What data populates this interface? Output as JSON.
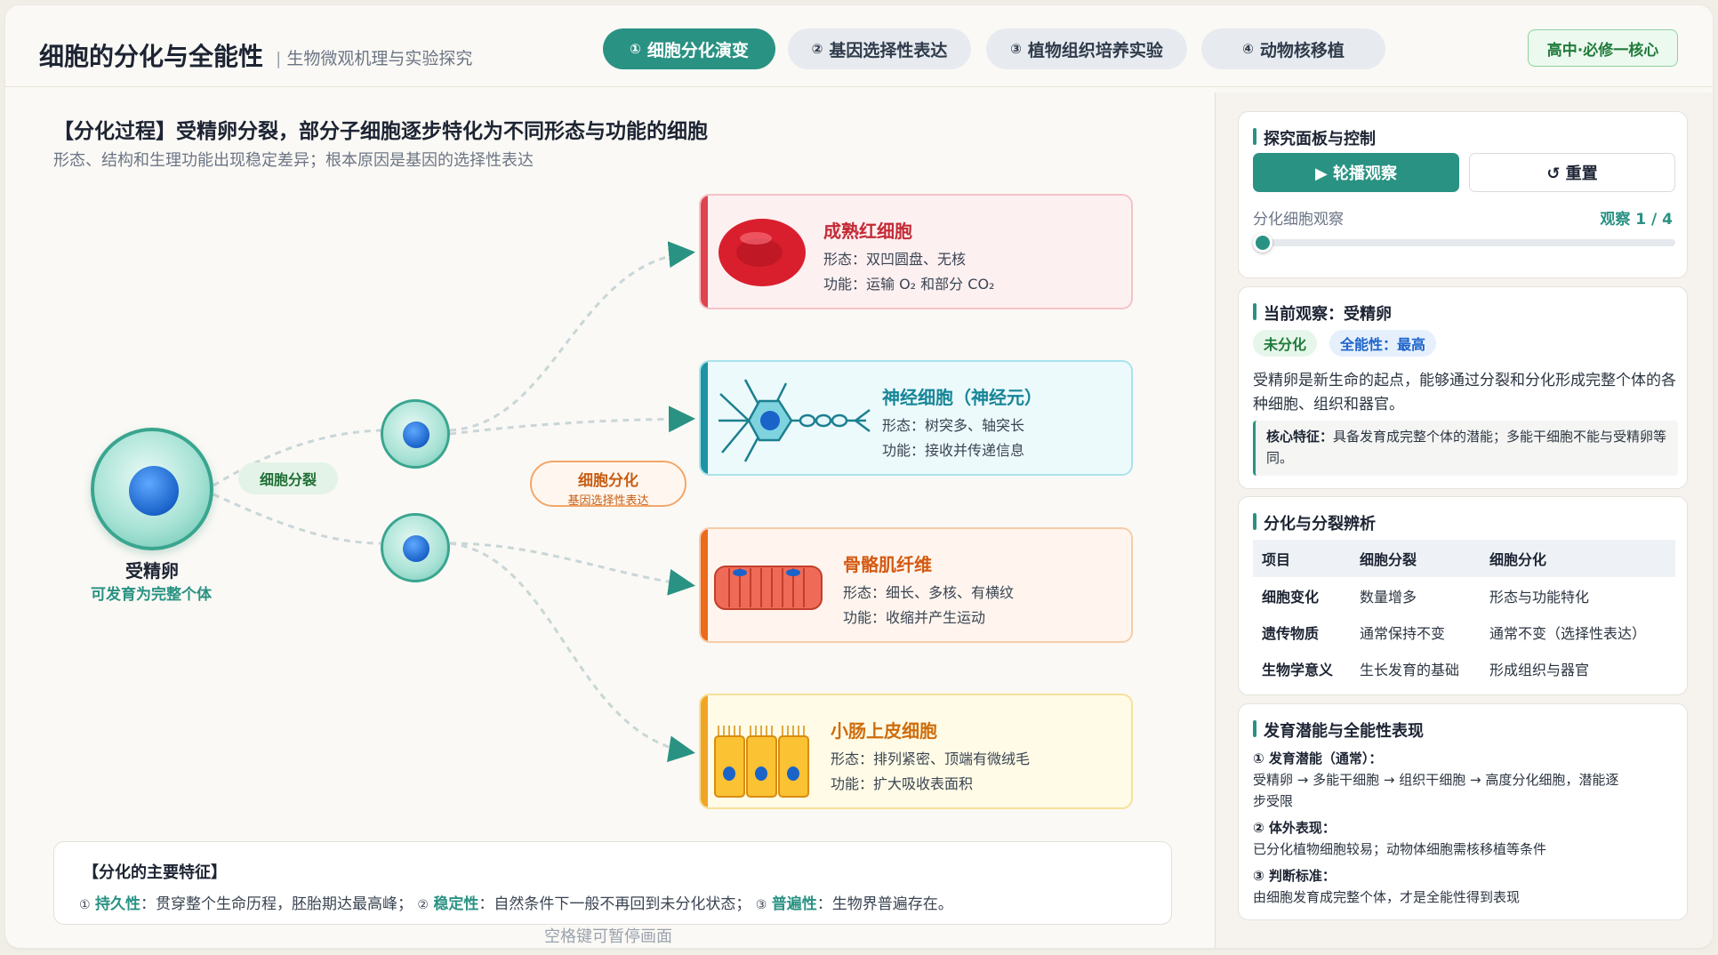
{
  "header": {
    "title": "细胞的分化与全能性",
    "separator": "|",
    "subtitle": "生物微观机理与实验探究",
    "tabs": [
      {
        "num": "①",
        "label": "细胞分化演变",
        "active": true
      },
      {
        "num": "②",
        "label": "基因选择性表达",
        "active": false
      },
      {
        "num": "③",
        "label": "植物组织培养实验",
        "active": false
      },
      {
        "num": "④",
        "label": "动物核移植",
        "active": false
      }
    ],
    "level_badge": "高中·必修一核心"
  },
  "main": {
    "title": "【分化过程】受精卵分裂，部分子细胞逐步特化为不同形态与功能的细胞",
    "subtitle": "形态、结构和生理功能出现稳定差异；根本原因是基因的选择性表达",
    "zygote": {
      "name": "受精卵",
      "note": "可发育为完整个体"
    },
    "division_label": "细胞分裂",
    "differentiation_label": "细胞分化",
    "differentiation_note": "基因选择性表达",
    "cells": [
      {
        "name": "成熟红细胞",
        "shape": "形态：双凹圆盘、无核",
        "function": "功能：运输 O₂ 和部分 CO₂",
        "color": "#e0434f"
      },
      {
        "name": "神经细胞（神经元）",
        "shape": "形态：树突多、轴突长",
        "function": "功能：接收并传递信息",
        "color": "#1c94a6"
      },
      {
        "name": "骨骼肌纤维",
        "shape": "形态：细长、多核、有横纹",
        "function": "功能：收缩并产生运动",
        "color": "#ec6a1c"
      },
      {
        "name": "小肠上皮细胞",
        "shape": "形态：排列紧密、顶端有微绒毛",
        "function": "功能：扩大吸收表面积",
        "color": "#f0a526"
      }
    ],
    "features": {
      "title": "【分化的主要特征】",
      "items": [
        {
          "num": "①",
          "key": "持久性",
          "text": "：贯穿整个生命历程，胚胎期达最高峰；"
        },
        {
          "num": "②",
          "key": "稳定性",
          "text": "：自然条件下一般不再回到未分化状态；"
        },
        {
          "num": "③",
          "key": "普遍性",
          "text": "：生物界普遍存在。"
        }
      ]
    },
    "hint": "空格键可暂停画面"
  },
  "panel": {
    "control": {
      "title": "探究面板与控制",
      "play_label": "▶ 轮播观察",
      "reset_label": "↺ 重置",
      "slider_label": "分化细胞观察",
      "slider_value": "观察 1 / 4",
      "slider_position": 1,
      "slider_max": 4
    },
    "current": {
      "title": "当前观察：受精卵",
      "badge_state": "未分化",
      "badge_potency": "全能性：最高",
      "description": "受精卵是新生命的起点，能够通过分裂和分化形成完整个体的各种细胞、组织和器官。",
      "core_label": "核心特征：",
      "core_text": "具备发育成完整个体的潜能；多能干细胞不能与受精卵等同。"
    },
    "compare": {
      "title": "分化与分裂辨析",
      "headers": [
        "项目",
        "细胞分裂",
        "细胞分化"
      ],
      "rows": [
        [
          "细胞变化",
          "数量增多",
          "形态与功能特化"
        ],
        [
          "遗传物质",
          "通常保持不变",
          "通常不变（选择性表达）"
        ],
        [
          "生物学意义",
          "生长发育的基础",
          "形成组织与器官"
        ]
      ]
    },
    "potency": {
      "title": "发育潜能与全能性表现",
      "items": [
        {
          "heading": "① 发育潜能（通常）：",
          "lines": [
            "受精卵 → 多能干细胞 → 组织干细胞 → 高度分化细胞，潜能逐",
            "步受限"
          ]
        },
        {
          "heading": "② 体外表现：",
          "lines": [
            "已分化植物细胞较易；动物体细胞需核移植等条件"
          ]
        },
        {
          "heading": "③ 判断标准：",
          "lines": [
            "由细胞发育成完整个体，才是全能性得到表现"
          ]
        }
      ]
    }
  },
  "colors": {
    "accent": "#2a9283",
    "red": "#e0434f",
    "teal": "#1c94a6",
    "orange": "#ec6a1c",
    "yellow": "#f0a526"
  }
}
